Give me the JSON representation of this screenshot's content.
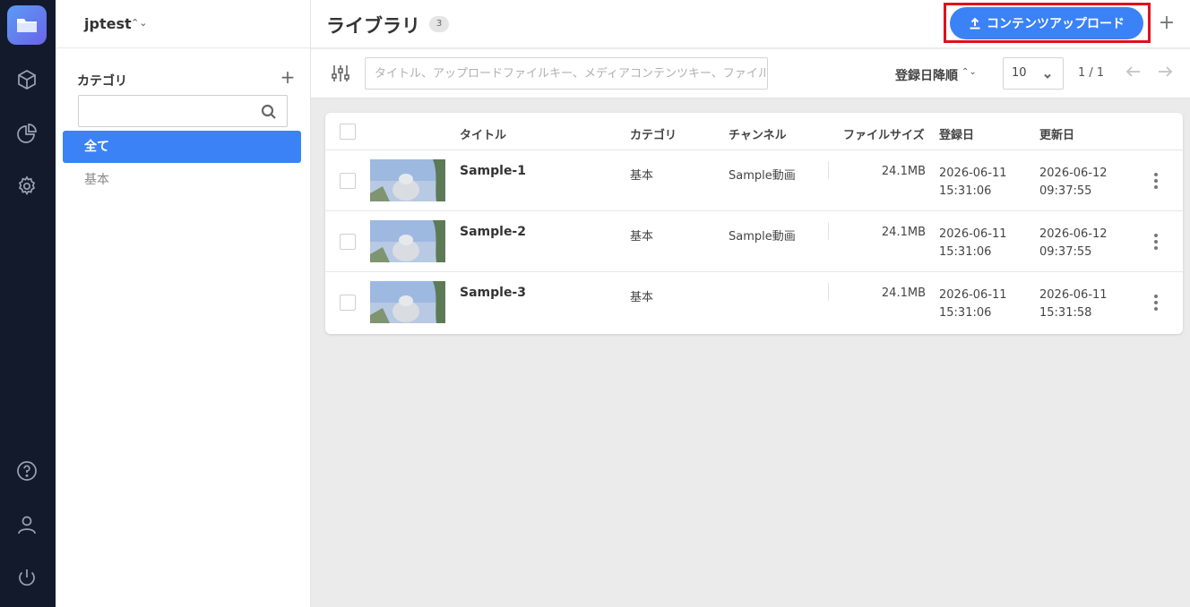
{
  "workspace": {
    "name": "jptest",
    "caret": "⌃⌄"
  },
  "sidebar_rail": {
    "icons": [
      "folder-icon",
      "cube-icon",
      "pie-chart-icon",
      "gear-icon",
      "help-icon",
      "user-icon",
      "power-icon"
    ]
  },
  "categories": {
    "title": "カテゴリ",
    "add": "+",
    "search_placeholder": "",
    "items": [
      {
        "label": "全て",
        "active": true
      },
      {
        "label": "基本",
        "active": false
      }
    ]
  },
  "header": {
    "title": "ライブラリ",
    "count": "3",
    "upload_label": "コンテンツアップロード",
    "add": "+"
  },
  "toolbar": {
    "search_placeholder": "タイトル、アップロードファイルキー、メディアコンテンツキー、ファイル名",
    "sort_label": "登録日降順",
    "sort_caret": "⌃⌄",
    "page_size": "10",
    "pager": "1 / 1"
  },
  "table": {
    "columns": {
      "title": "タイトル",
      "category": "カテゴリ",
      "channel": "チャンネル",
      "size": "ファイルサイズ",
      "registered": "登録日",
      "updated": "更新日"
    },
    "rows": [
      {
        "title": "Sample-1",
        "category": "基本",
        "channel": "Sample動画",
        "size": "24.1MB",
        "reg_date": "2026-06-11",
        "reg_time": "15:31:06",
        "upd_date": "2026-06-12",
        "upd_time": "09:37:55"
      },
      {
        "title": "Sample-2",
        "category": "基本",
        "channel": "Sample動画",
        "size": "24.1MB",
        "reg_date": "2026-06-11",
        "reg_time": "15:31:06",
        "upd_date": "2026-06-12",
        "upd_time": "09:37:55"
      },
      {
        "title": "Sample-3",
        "category": "基本",
        "channel": "",
        "size": "24.1MB",
        "reg_date": "2026-06-11",
        "reg_time": "15:31:06",
        "upd_date": "2026-06-11",
        "upd_time": "15:31:58"
      }
    ]
  },
  "colors": {
    "accent": "#3b82f6",
    "rail": "#121a2c",
    "highlight": "#e0101a"
  }
}
